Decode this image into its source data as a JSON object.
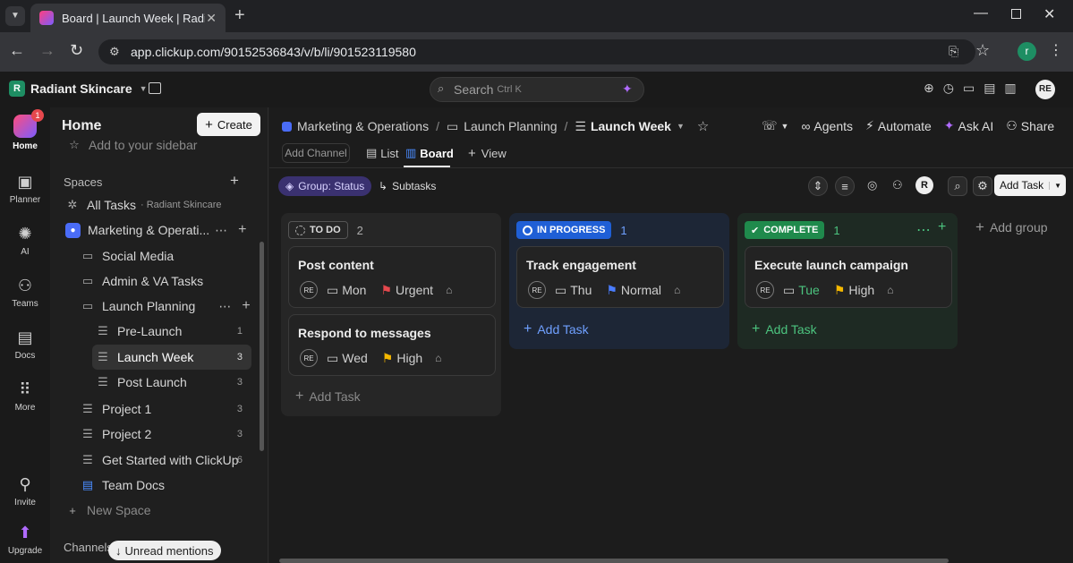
{
  "browser": {
    "tab_title": "Board | Launch Week | Radiant S",
    "url": "app.clickup.com/90152536843/v/b/li/901523119580"
  },
  "workspace": {
    "initial": "R",
    "name": "Radiant Skincare"
  },
  "search": {
    "placeholder": "Search",
    "shortcut": "Ctrl K"
  },
  "user": {
    "initials": "RE",
    "profile_initial": "r"
  },
  "rail": {
    "home": "Home",
    "home_badge": "1",
    "planner": "Planner",
    "ai": "AI",
    "teams": "Teams",
    "docs": "Docs",
    "more": "More",
    "invite": "Invite",
    "upgrade": "Upgrade"
  },
  "sidebar": {
    "title": "Home",
    "create": "Create",
    "add_to_sidebar": "Add to your sidebar",
    "spaces_label": "Spaces",
    "all_tasks": "All Tasks",
    "all_tasks_sub": "· Radiant Skincare",
    "space_name": "Marketing & Operati...",
    "folders": [
      {
        "label": "Social Media"
      },
      {
        "label": "Admin & VA Tasks"
      },
      {
        "label": "Launch Planning"
      }
    ],
    "lists": [
      {
        "label": "Pre-Launch",
        "count": "1"
      },
      {
        "label": "Launch Week",
        "count": "3"
      },
      {
        "label": "Post Launch",
        "count": "3"
      }
    ],
    "projects": [
      {
        "label": "Project 1",
        "count": "3"
      },
      {
        "label": "Project 2",
        "count": "3"
      },
      {
        "label": "Get Started with ClickUp",
        "count": "6"
      },
      {
        "label": "Team Docs",
        "count": ""
      }
    ],
    "new_space": "New Space",
    "channels": "Channels",
    "unread": "Unread mentions"
  },
  "breadcrumb": {
    "space": "Marketing & Operations",
    "folder": "Launch Planning",
    "list": "Launch Week"
  },
  "header_actions": {
    "agents": "Agents",
    "automate": "Automate",
    "ask_ai": "Ask AI",
    "share": "Share"
  },
  "views": {
    "add_channel": "Add Channel",
    "list": "List",
    "board": "Board",
    "add_view": "View"
  },
  "toolbar": {
    "group": "Group: Status",
    "subtasks": "Subtasks",
    "add_task": "Add Task",
    "assignee": "R"
  },
  "columns": [
    {
      "status": "TO DO",
      "count": "2",
      "color": "#3a3a3a",
      "tasks": [
        {
          "title": "Post content",
          "date": "Mon",
          "priority": "Urgent",
          "flag": "#e5484d"
        },
        {
          "title": "Respond to messages",
          "date": "Wed",
          "priority": "High",
          "flag": "#f5b800"
        }
      ]
    },
    {
      "status": "IN PROGRESS",
      "count": "1",
      "color": "#1f5fd6",
      "tasks": [
        {
          "title": "Track engagement",
          "date": "Thu",
          "priority": "Normal",
          "flag": "#4a7dff"
        }
      ]
    },
    {
      "status": "COMPLETE",
      "count": "1",
      "color": "#1f8a4c",
      "tasks": [
        {
          "title": "Execute launch campaign",
          "date": "Tue",
          "priority": "High",
          "flag": "#f5b800"
        }
      ]
    }
  ],
  "add_task_label": "Add Task",
  "add_group": "Add group"
}
